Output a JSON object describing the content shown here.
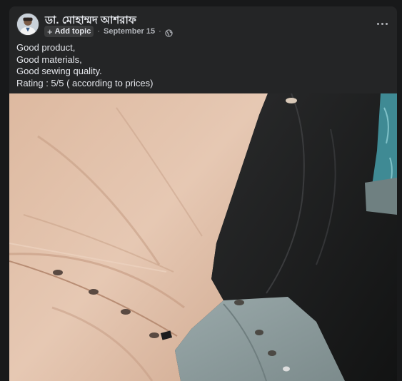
{
  "post": {
    "author": "ডা. মোহাম্মদ আশরাফ",
    "topic_button": "Add topic",
    "date": "September 15",
    "separator": "·",
    "privacy_icon": "globe-icon",
    "more_icon": "more-options-icon",
    "text_lines": [
      "Good product,",
      "Good materials,",
      "Good sewing quality.",
      "Rating : 5/5 ( according to prices)"
    ]
  },
  "colors": {
    "page_bg": "#18191a",
    "card_bg": "#242526",
    "primary_text": "#e4e6eb",
    "secondary_text": "#b0b3b8",
    "fabric_beige": "#dcbba4",
    "fabric_black": "#202122",
    "fabric_sage": "#8d9d9e"
  }
}
